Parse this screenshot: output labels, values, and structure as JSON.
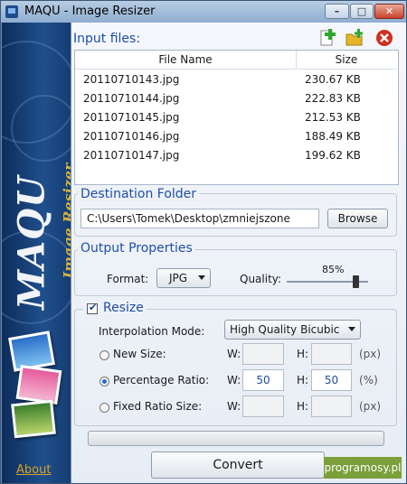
{
  "window": {
    "title": "MAQU - Image Resizer",
    "controls": {
      "minimize": "–",
      "maximize": "□",
      "close": "✕"
    }
  },
  "sidebar": {
    "brand": "MAQU",
    "subtitle": "Image Resizer",
    "about_link": "About"
  },
  "input_files": {
    "label": "Input files:",
    "toolbar": [
      {
        "name": "add-file-icon",
        "color": "#2ea82e"
      },
      {
        "name": "add-folder-icon",
        "color": "#e3b52a"
      },
      {
        "name": "remove-icon",
        "color": "#d03020"
      }
    ],
    "columns": [
      "File Name",
      "Size"
    ],
    "rows": [
      {
        "name": "20110710143.jpg",
        "size": "230.67 KB"
      },
      {
        "name": "20110710144.jpg",
        "size": "222.83 KB"
      },
      {
        "name": "20110710145.jpg",
        "size": "212.53 KB"
      },
      {
        "name": "20110710146.jpg",
        "size": "188.49 KB"
      },
      {
        "name": "20110710147.jpg",
        "size": "199.62 KB"
      }
    ]
  },
  "destination": {
    "label": "Destination Folder",
    "path": "C:\\Users\\Tomek\\Desktop\\zmniejszone",
    "browse": "Browse"
  },
  "output": {
    "label": "Output Properties",
    "format_label": "Format:",
    "format_value": "JPG",
    "quality_label": "Quality:",
    "quality_value": "85%",
    "quality_fraction": 0.85
  },
  "resize": {
    "label": "Resize",
    "checked": true,
    "interpolation_label": "Interpolation Mode:",
    "interpolation_value": "High Quality Bicubic",
    "options": [
      {
        "label": "New Size:",
        "selected": false,
        "w": "",
        "h": "",
        "unit": "(px)"
      },
      {
        "label": "Percentage Ratio:",
        "selected": true,
        "w": "50",
        "h": "50",
        "unit": "(%)"
      },
      {
        "label": "Fixed Ratio Size:",
        "selected": false,
        "w": "",
        "h": "",
        "unit": "(px)"
      }
    ],
    "w_label": "W:",
    "h_label": "H:"
  },
  "progress": {
    "value": 0
  },
  "convert_button": "Convert",
  "watermark": "programosy.pl"
}
